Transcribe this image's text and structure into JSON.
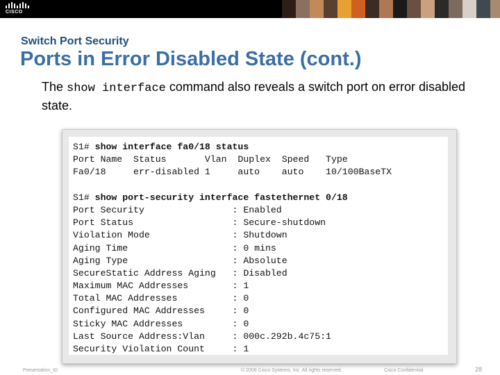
{
  "header": {
    "logo_text": "CISCO",
    "photos": [
      "#2d1f18",
      "#8a7060",
      "#c28a5a",
      "#5a4030",
      "#e8a030",
      "#d06020",
      "#3a2c24",
      "#b07850",
      "#1a1a1a",
      "#6a5040",
      "#caa080",
      "#2a2a2a",
      "#7c6a5e",
      "#d8d0c8",
      "#404850",
      "#a88a70"
    ]
  },
  "slide": {
    "section": "Switch Port Security",
    "title": "Ports in Error Disabled State (cont.)",
    "body_before": "The ",
    "body_cmd": "show interface",
    "body_after": " command also reveals a switch port on error disabled state."
  },
  "terminal": {
    "lines": [
      {
        "prompt": "S1# ",
        "cmd": "show interface fa0/18 status"
      },
      {
        "text": "Port Name  Status       Vlan  Duplex  Speed   Type"
      },
      {
        "text": "Fa0/18     err-disabled 1     auto    auto    10/100BaseTX"
      },
      {
        "text": ""
      },
      {
        "prompt": "S1# ",
        "cmd": "show port-security interface fastethernet 0/18"
      },
      {
        "text": "Port Security                : Enabled"
      },
      {
        "text": "Port Status                  : Secure-shutdown"
      },
      {
        "text": "Violation Mode               : Shutdown"
      },
      {
        "text": "Aging Time                   : 0 mins"
      },
      {
        "text": "Aging Type                   : Absolute"
      },
      {
        "text": "SecureStatic Address Aging   : Disabled"
      },
      {
        "text": "Maximum MAC Addresses        : 1"
      },
      {
        "text": "Total MAC Addresses          : 0"
      },
      {
        "text": "Configured MAC Addresses     : 0"
      },
      {
        "text": "Sticky MAC Addresses         : 0"
      },
      {
        "text": "Last Source Address:Vlan     : 000c.292b.4c75:1"
      },
      {
        "text": "Security Violation Count     : 1"
      }
    ]
  },
  "footer": {
    "left": "Presentation_ID",
    "center": "© 2008 Cisco Systems, Inc. All rights reserved.",
    "right": "Cisco Confidential",
    "page": "28"
  }
}
